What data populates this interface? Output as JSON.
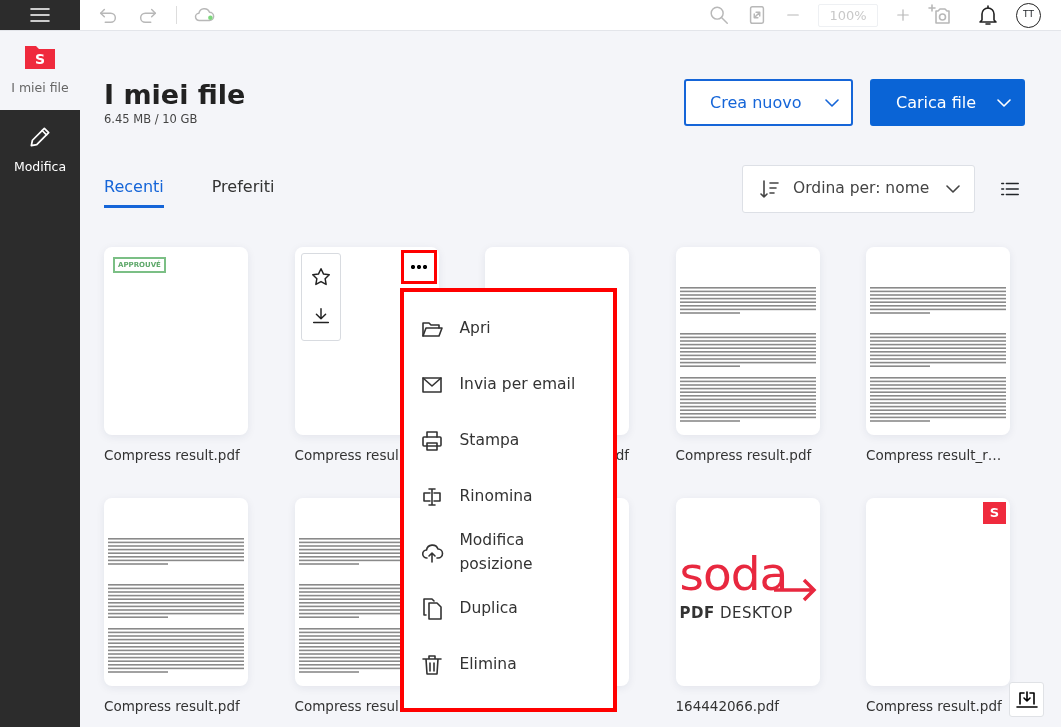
{
  "toolbar": {
    "zoom": "100%",
    "avatar": "TT"
  },
  "sidebar": {
    "logo": "S",
    "items": [
      {
        "label": "I miei file",
        "kind": "files",
        "selected": true
      },
      {
        "label": "Modifica",
        "kind": "edit",
        "selected": false
      }
    ]
  },
  "header": {
    "title": "I miei file",
    "storage": "6.45 MB / 10 GB",
    "buttons": [
      {
        "label": "Crea nuovo",
        "kind": "outline"
      },
      {
        "label": "Carica file",
        "kind": "primary"
      }
    ]
  },
  "tabs": [
    {
      "label": "Recenti",
      "selected": true
    },
    {
      "label": "Preferiti",
      "selected": false
    }
  ],
  "sort": {
    "label": "Ordina per: nome"
  },
  "files": [
    {
      "name": "Compress result.pdf",
      "menu_open": false,
      "thumbnail": {
        "kind": "stamp",
        "text": "APPROUVÉ"
      }
    },
    {
      "name": "Compress resul",
      "menu_open": true,
      "thumbnail": {
        "kind": "blank"
      }
    },
    {
      "name": "df",
      "cut_left": true,
      "menu_open": false,
      "thumbnail": {
        "kind": "blank"
      }
    },
    {
      "name": "Compress result.pdf",
      "menu_open": false,
      "thumbnail": {
        "kind": "text"
      }
    },
    {
      "name": "Compress result_r…",
      "menu_open": false,
      "thumbnail": {
        "kind": "text"
      }
    },
    {
      "name": "Compress result.pdf",
      "menu_open": false,
      "thumbnail": {
        "kind": "text"
      }
    },
    {
      "name": "Compress resul",
      "menu_open": false,
      "thumbnail": {
        "kind": "text"
      }
    },
    {
      "menu_open": false,
      "thumbnail": {
        "kind": "blank"
      }
    },
    {
      "name": "164442066.pdf",
      "menu_open": false,
      "thumbnail": {
        "kind": "logo",
        "text": "soda",
        "subtitle": "**PDF** DESKTOP"
      }
    },
    {
      "name": "Compress result.pdf",
      "menu_open": false,
      "thumbnail": {
        "kind": "badge",
        "text": "S"
      }
    }
  ],
  "context_menu": {
    "items": [
      {
        "label": "Apri",
        "kind": "open"
      },
      {
        "label": "Invia per email",
        "kind": "email"
      },
      {
        "label": "Stampa",
        "kind": "print"
      },
      {
        "label": "Rinomina",
        "kind": "rename"
      },
      {
        "label": "Modifica posizione",
        "kind": "move"
      },
      {
        "label": "Duplica",
        "kind": "duplicate"
      },
      {
        "label": "Elimina",
        "kind": "delete"
      }
    ]
  }
}
